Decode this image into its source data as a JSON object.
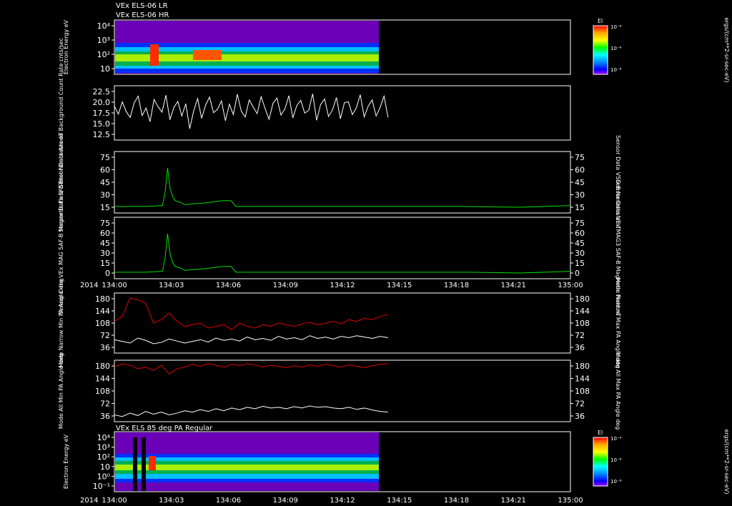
{
  "panel_titles": {
    "top_1": "VEx ELS-06 LR",
    "top_2": "VEx ELS-06 HR",
    "bottom": "VEx ELS 85 deg PA Regular"
  },
  "colorbar": {
    "title": "El",
    "units": "ergs/(cm**2-sr-sec-eV)",
    "ticks": [
      "10⁻⁴",
      "10⁻⁶",
      "10⁻⁸"
    ],
    "colors": [
      "#ff0000",
      "#ffaa00",
      "#ffff00",
      "#00ff00",
      "#00ffff",
      "#0088ff",
      "#0000ff",
      "#6600ff",
      "#aa00ff"
    ]
  },
  "time_axis": {
    "year": "2014",
    "ticks": [
      "134:00",
      "134:03",
      "134:06",
      "134:09",
      "134:12",
      "134:15",
      "134:18",
      "134:21",
      "135:00"
    ]
  },
  "chart_data": [
    {
      "type": "heatmap",
      "title": "VEx ELS-06 LR / VEx ELS-06 HR",
      "ylabel": "Electron Energy eV",
      "y_scale": "log",
      "yticks": [
        "10⁴",
        "10³",
        "10²",
        "10"
      ],
      "data_end": "134:13",
      "colors": {
        "background": "#6a00b8",
        "core": "#00b050",
        "peak": "#ff2a00"
      }
    },
    {
      "type": "line",
      "ylabel": "Sensor Data Anode Background Count Rate cnts/sec",
      "ylim": [
        11,
        22.5
      ],
      "yticks": [
        "22.5",
        "20.0",
        "17.5",
        "15.0",
        "12.5"
      ],
      "color": "#ffffff",
      "x_end": "134:13",
      "values": [
        18.2,
        16.5,
        19.1,
        17.0,
        15.8,
        18.9,
        20.3,
        16.2,
        17.8,
        14.9,
        19.6,
        18.1,
        16.9,
        20.5,
        15.3,
        17.9,
        19.2,
        16.1,
        18.7,
        13.4,
        17.2,
        19.8,
        15.6,
        18.4,
        20.1,
        16.8,
        17.5,
        19.3,
        15.1,
        18.6,
        16.4,
        20.7,
        17.1,
        15.9,
        19.5,
        18.0,
        16.6,
        20.2,
        17.7,
        15.4,
        18.8,
        19.9,
        16.3,
        17.6,
        20.4,
        15.7,
        18.3,
        19.4,
        16.7,
        17.3,
        20.8,
        15.2,
        18.5,
        19.7,
        16.0,
        17.4,
        20.0,
        15.5,
        18.9,
        19.1,
        16.4,
        17.8,
        20.6,
        15.9,
        18.2,
        19.5,
        16.1,
        17.9,
        20.3,
        15.8
      ]
    },
    {
      "type": "line",
      "ylabel_left": "Sensor Data S/C Btot Nanotesla nT",
      "ylabel_right": "Sensor Data VSO B Nanotesla nT",
      "ylim": [
        0,
        75
      ],
      "yticks": [
        "75",
        "60",
        "45",
        "30",
        "15"
      ],
      "color": "#00dd00",
      "x": [
        0,
        12,
        19,
        20,
        21,
        22,
        23,
        24,
        26,
        28,
        30,
        35,
        40,
        43,
        46,
        48,
        50,
        55,
        60,
        70,
        80,
        100,
        120,
        140,
        160,
        180
      ],
      "values": [
        8,
        8,
        9,
        25,
        55,
        30,
        20,
        15,
        13,
        10,
        11,
        12,
        14,
        15,
        15,
        8,
        8,
        8,
        8,
        8,
        8,
        8,
        8,
        8,
        7,
        9
      ]
    },
    {
      "type": "line",
      "ylabel_left": "Sensor Data VEx MAG SAF-B Magnetic Field nT",
      "ylabel_right": "Sensor Data VEx MAG3 SAF-B Magnetic Field nT",
      "ylim": [
        0,
        75
      ],
      "yticks": [
        "75",
        "60",
        "45",
        "30",
        "15",
        "0"
      ],
      "color": "#00dd00",
      "x": [
        0,
        12,
        19,
        20,
        21,
        22,
        23,
        24,
        26,
        28,
        30,
        35,
        40,
        43,
        46,
        48,
        50,
        55,
        60,
        70,
        80,
        100,
        120,
        140,
        160,
        180
      ],
      "values": [
        8,
        8,
        9,
        25,
        55,
        30,
        20,
        15,
        13,
        10,
        11,
        12,
        14,
        15,
        15,
        8,
        8,
        8,
        8,
        8,
        8,
        8,
        8,
        8,
        7,
        9
      ]
    },
    {
      "type": "line",
      "ylabel_left": "Mode Narrow Min PA Angle deg",
      "ylabel_right": "Mode Narrow Max PA Angle deg",
      "ylim": [
        0,
        180
      ],
      "yticks": [
        "180",
        "144",
        "108",
        "72",
        "36"
      ],
      "x_end": "134:13",
      "series": [
        {
          "color": "#ffffff",
          "values": [
            40,
            35,
            30,
            45,
            38,
            28,
            32,
            42,
            36,
            30,
            35,
            40,
            33,
            45,
            38,
            42,
            36,
            48,
            40,
            44,
            38,
            50,
            42,
            46,
            40,
            52,
            44,
            48,
            42,
            50,
            46,
            52,
            48,
            44,
            50,
            46
          ]
        },
        {
          "color": "#dd0000",
          "values": [
            95,
            110,
            165,
            160,
            150,
            90,
            100,
            120,
            95,
            80,
            85,
            90,
            75,
            80,
            85,
            70,
            90,
            80,
            75,
            85,
            80,
            90,
            85,
            80,
            88,
            92,
            85,
            90,
            95,
            88,
            100,
            95,
            105,
            100,
            110,
            115
          ]
        }
      ]
    },
    {
      "type": "line",
      "ylabel_left": "Mode All Min PA Angle deg",
      "ylabel_right": "Mode All Max PA Angle deg",
      "ylim": [
        0,
        180
      ],
      "yticks": [
        "180",
        "144",
        "108",
        "72",
        "36"
      ],
      "x_end": "134:13",
      "series": [
        {
          "color": "#ffffff",
          "values": [
            20,
            15,
            25,
            18,
            30,
            22,
            28,
            20,
            25,
            32,
            28,
            35,
            30,
            38,
            32,
            40,
            35,
            42,
            38,
            45,
            40,
            42,
            38,
            44,
            40,
            46,
            42,
            44,
            40,
            38,
            42,
            36,
            40,
            34,
            30,
            28
          ]
        },
        {
          "color": "#dd0000",
          "values": [
            160,
            170,
            165,
            155,
            160,
            150,
            165,
            140,
            155,
            160,
            168,
            162,
            170,
            165,
            160,
            168,
            164,
            170,
            166,
            160,
            165,
            162,
            158,
            164,
            160,
            166,
            162,
            168,
            164,
            160,
            166,
            162,
            158,
            164,
            168,
            170
          ]
        }
      ]
    },
    {
      "type": "heatmap",
      "title": "VEx ELS 85 deg PA Regular",
      "ylabel": "Electron Energy eV",
      "y_scale": "log",
      "yticks": [
        "10⁴",
        "10³",
        "10²",
        "10",
        "10⁰",
        "10⁻¹"
      ],
      "data_end": "134:13",
      "colors": {
        "background": "#6a00b8",
        "core": "#00b050",
        "peak": "#ff2a00"
      }
    }
  ]
}
